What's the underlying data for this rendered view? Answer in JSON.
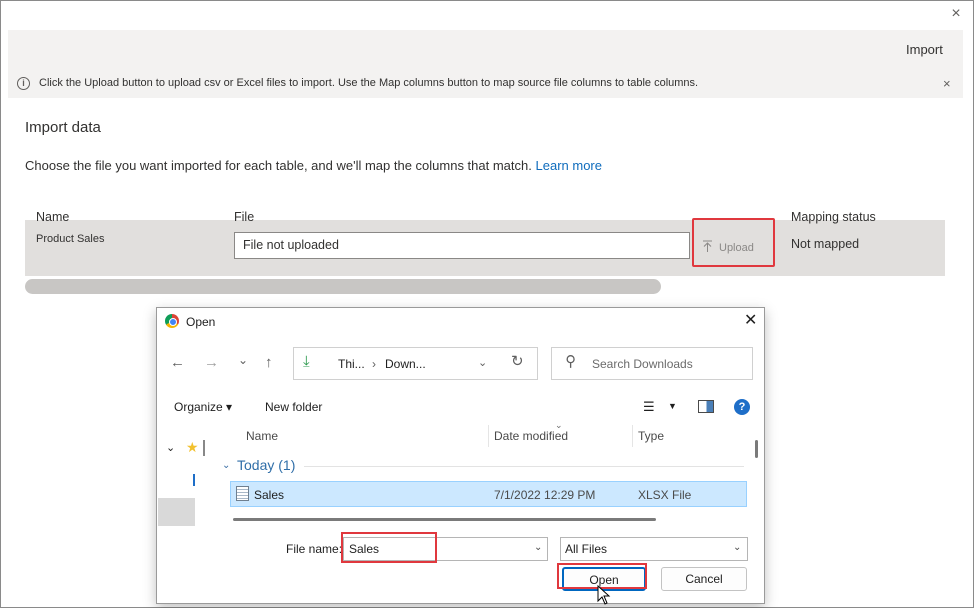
{
  "window": {
    "close_icon": "×",
    "import_label": "Import"
  },
  "info_bar": {
    "icon": "i",
    "message": "Click the Upload button to upload csv or Excel files to import. Use the Map columns button to map source file columns to table columns.",
    "close_icon": "×"
  },
  "import": {
    "title": "Import data",
    "description": "Choose the file you want imported for each table, and we'll map the columns that match.",
    "learn_more": "Learn more",
    "columns": {
      "name": "Name",
      "file": "File",
      "mapping_status": "Mapping status"
    },
    "row": {
      "name": "Product Sales",
      "file_status": "File not uploaded",
      "upload_label": "Upload",
      "mapping_status": "Not mapped"
    }
  },
  "dialog": {
    "title": "Open",
    "close_icon": "✕",
    "nav": {
      "back": "←",
      "forward": "→",
      "recent": "⌄",
      "up": "↑"
    },
    "address": {
      "download_icon": "⤓",
      "part1": "Thi...",
      "sep": "›",
      "part2": "Down...",
      "chevron": "⌄",
      "refresh": "↻"
    },
    "search_placeholder": "Search Downloads",
    "toolbar": {
      "organize": "Organize ▾",
      "new_folder": "New folder",
      "view_icon": "☰",
      "view_chev": "▼",
      "help": "?"
    },
    "tree": {
      "chevron": "⌄",
      "star": "★"
    },
    "file_columns": {
      "name": "Name",
      "date_modified": "Date modified",
      "type": "Type"
    },
    "group": {
      "chevron": "⌄",
      "label": "Today (1)"
    },
    "files": [
      {
        "name": "Sales",
        "date": "7/1/2022 12:29 PM",
        "type": "XLSX File"
      }
    ],
    "file_name_label": "File name:",
    "file_name_value": "Sales",
    "file_type_value": "All Files",
    "combo_chevron": "⌄",
    "open_label": "Open",
    "cancel_label": "Cancel"
  },
  "colors": {
    "highlight": "#e0383e",
    "link": "#0f6cbd",
    "selection": "#cce8ff",
    "primary_border": "#0067c0"
  }
}
